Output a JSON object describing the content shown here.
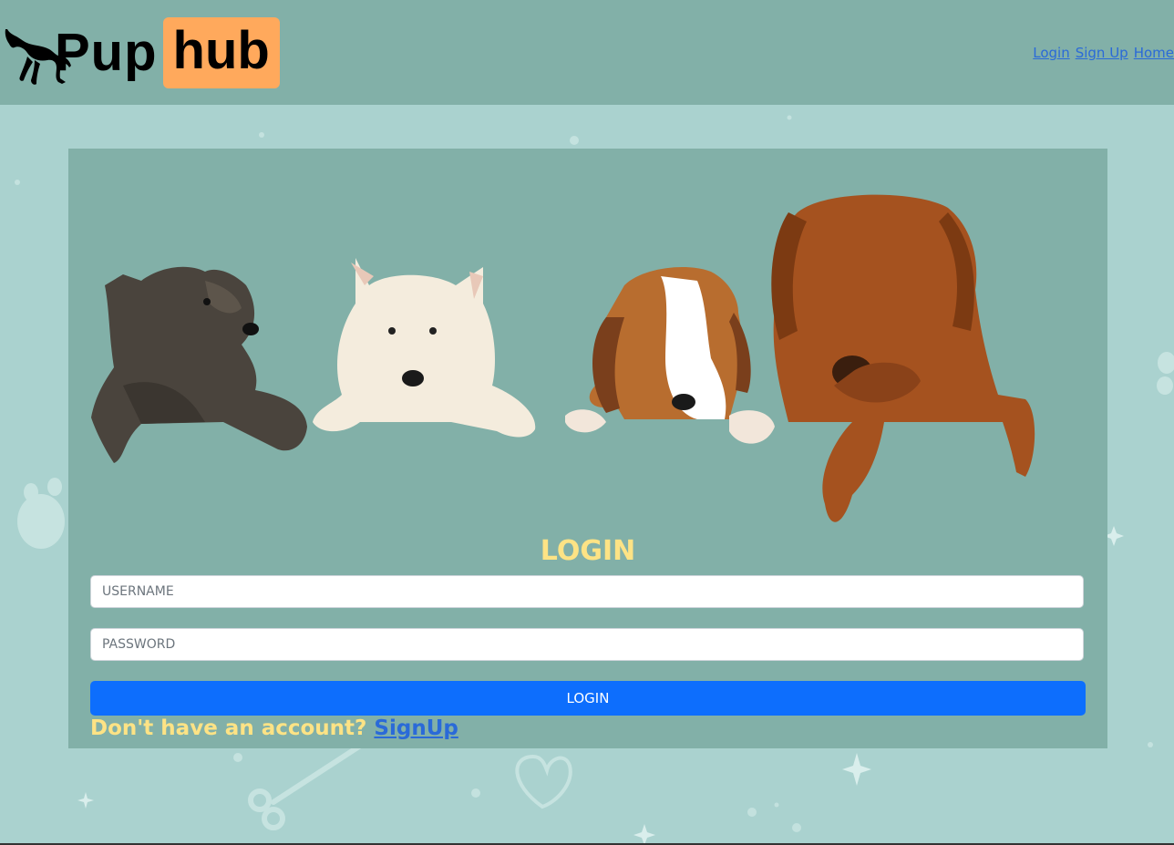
{
  "header": {
    "logo_text_1": "Pup",
    "logo_text_2": "hub",
    "nav": [
      {
        "label": "Login"
      },
      {
        "label": "Sign Up"
      },
      {
        "label": "Home"
      }
    ]
  },
  "login": {
    "title": "LOGIN",
    "username_placeholder": "USERNAME",
    "password_placeholder": "PASSWORD",
    "submit_label": "LOGIN",
    "prompt_text": "Don't have an account?",
    "signup_link": "SignUp"
  },
  "colors": {
    "page_bg": "#aad2cf",
    "header_bg": "#82b0a8",
    "card_bg": "#82b0a8",
    "logo_accent": "#ffa95c",
    "title_yellow": "#fde385",
    "button_blue": "#0d6efd",
    "link_blue": "#2a6ad8"
  },
  "icons": [
    "dog-silhouette-icon",
    "paw-icon",
    "bone-icon",
    "heart-icon",
    "sparkle-icon"
  ]
}
